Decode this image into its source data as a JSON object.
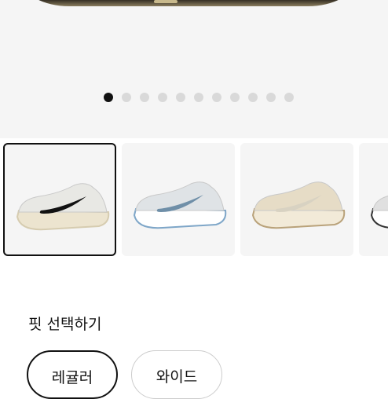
{
  "gallery": {
    "total_slides": 11,
    "active_slide": 1
  },
  "thumbnails": [
    {
      "name": "colorway-white-black",
      "selected": true,
      "upper": "#e8e8e4",
      "swoosh": "#111111",
      "sole": "#ece4cf",
      "accent": "#d6ccb0"
    },
    {
      "name": "colorway-white-blue",
      "selected": false,
      "upper": "#dfe3e6",
      "swoosh": "#6f8fa8",
      "sole": "#ffffff",
      "accent": "#7ea6c8"
    },
    {
      "name": "colorway-sand",
      "selected": false,
      "upper": "#e6dcc6",
      "swoosh": "#d8d2c2",
      "sole": "#f2ead8",
      "accent": "#b9a27a"
    },
    {
      "name": "colorway-partial",
      "selected": false,
      "upper": "#e0e0e0",
      "swoosh": "#222222",
      "sole": "#ffffff",
      "accent": "#333333"
    }
  ],
  "fit": {
    "title": "핏 선택하기",
    "options": [
      {
        "label": "레귤러",
        "selected": true
      },
      {
        "label": "와이드",
        "selected": false
      }
    ]
  }
}
